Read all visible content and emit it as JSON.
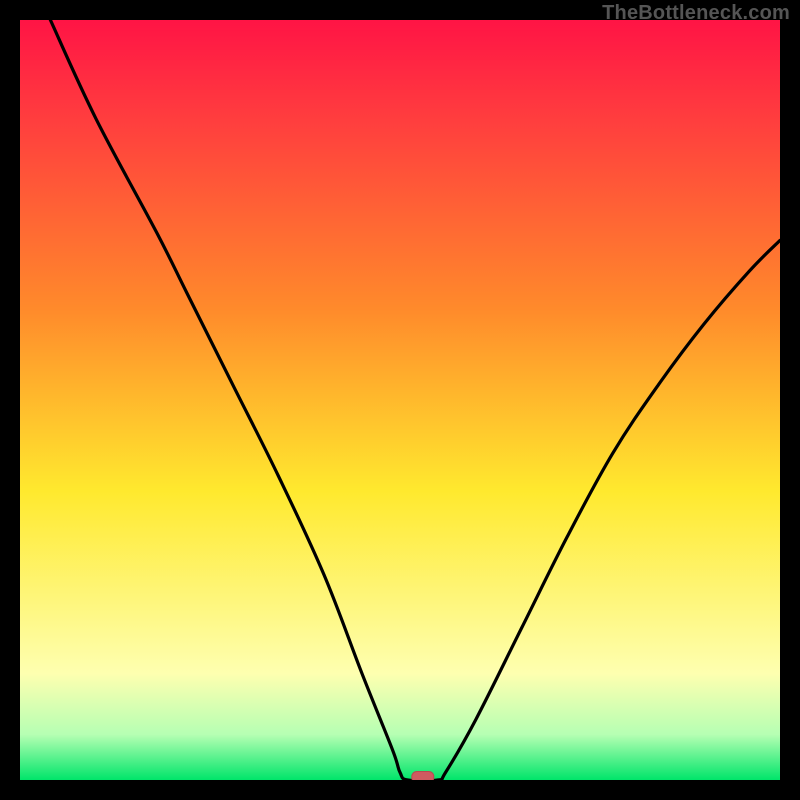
{
  "watermark": "TheBottleneck.com",
  "colors": {
    "bg": "#000000",
    "watermark": "#555555",
    "curve": "#000000",
    "marker_fill": "#cf5a60",
    "marker_stroke": "#b84a50",
    "grad_top": "#ff1445",
    "grad_red": "#ff3a3f",
    "grad_orange": "#ff8a2b",
    "grad_yellow": "#ffe92e",
    "grad_paleyellow": "#feffb0",
    "grad_lightgreen": "#b6ffb3",
    "grad_green": "#00e56a"
  },
  "chart_data": {
    "type": "line",
    "title": "",
    "xlabel": "",
    "ylabel": "",
    "xlim": [
      0,
      100
    ],
    "ylim": [
      0,
      100
    ],
    "min_point": {
      "x": 53,
      "y": 0
    },
    "curve": [
      {
        "x": 4,
        "y": 100
      },
      {
        "x": 10,
        "y": 87
      },
      {
        "x": 18,
        "y": 72
      },
      {
        "x": 22,
        "y": 64
      },
      {
        "x": 28,
        "y": 52
      },
      {
        "x": 34,
        "y": 40
      },
      {
        "x": 40,
        "y": 27
      },
      {
        "x": 45,
        "y": 14
      },
      {
        "x": 49,
        "y": 4
      },
      {
        "x": 50,
        "y": 1
      },
      {
        "x": 51,
        "y": 0
      },
      {
        "x": 55,
        "y": 0
      },
      {
        "x": 56,
        "y": 1
      },
      {
        "x": 60,
        "y": 8
      },
      {
        "x": 66,
        "y": 20
      },
      {
        "x": 72,
        "y": 32
      },
      {
        "x": 78,
        "y": 43
      },
      {
        "x": 84,
        "y": 52
      },
      {
        "x": 90,
        "y": 60
      },
      {
        "x": 96,
        "y": 67
      },
      {
        "x": 100,
        "y": 71
      }
    ]
  }
}
